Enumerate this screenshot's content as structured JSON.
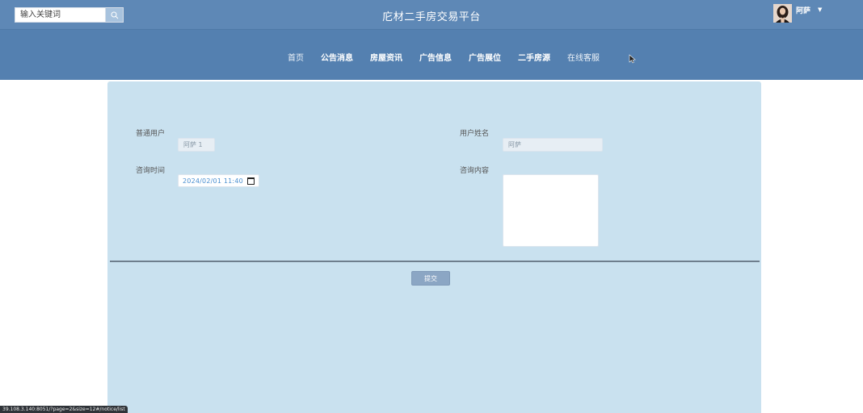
{
  "header": {
    "search_placeholder": "输入关键词",
    "title": "庀材二手房交易平台",
    "user_name": "阿萨"
  },
  "nav": {
    "items": [
      "首页",
      "公告消息",
      "房屋资讯",
      "广告信息",
      "广告展位",
      "二手房源",
      "在线客服"
    ]
  },
  "form": {
    "user_label": "普通用户",
    "user_value": "阿萨 1",
    "name_label": "用户姓名",
    "name_value": "阿萨",
    "time_label": "咨询时间",
    "time_value": "2024/02/01 11:40",
    "content_label": "咨询内容",
    "submit_label": "提交"
  },
  "status_bar": {
    "url": "39.108.3.140:8051/?page=2&size=12#/notice/list"
  },
  "colors": {
    "topbar": "#5e88b6",
    "navbar": "#5480b0",
    "panel": "#c9e1ef",
    "button": "#8ba6c4"
  }
}
